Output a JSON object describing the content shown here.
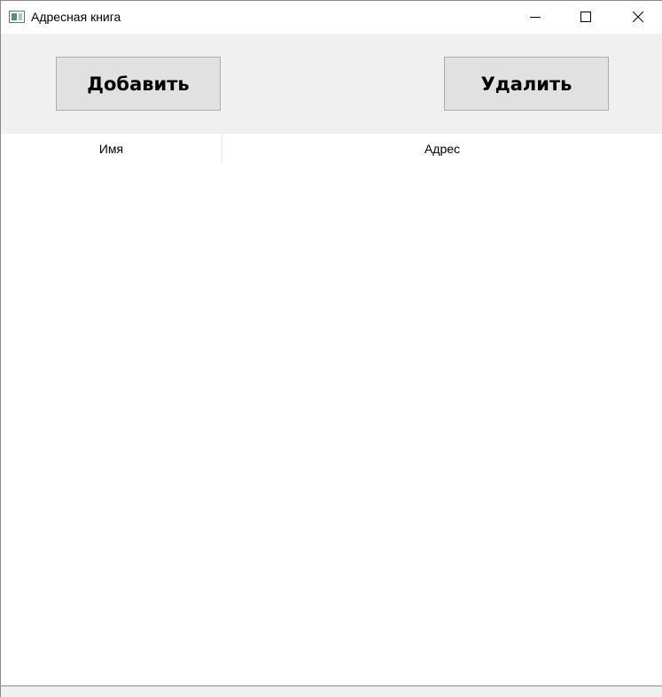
{
  "window": {
    "title": "Адресная книга",
    "app_icon": "app-window-icon",
    "controls": {
      "minimize_icon": "minimize-icon",
      "maximize_icon": "maximize-icon",
      "close_icon": "close-icon"
    }
  },
  "toolbar": {
    "add_label": "Добавить",
    "delete_label": "Удалить"
  },
  "table": {
    "columns": [
      "Имя",
      "Адрес"
    ],
    "rows": []
  },
  "colors": {
    "toolbar_bg": "#f0f0f0",
    "button_bg": "#e1e1e1",
    "button_border": "#adadad",
    "window_border": "#8a8a8a"
  }
}
